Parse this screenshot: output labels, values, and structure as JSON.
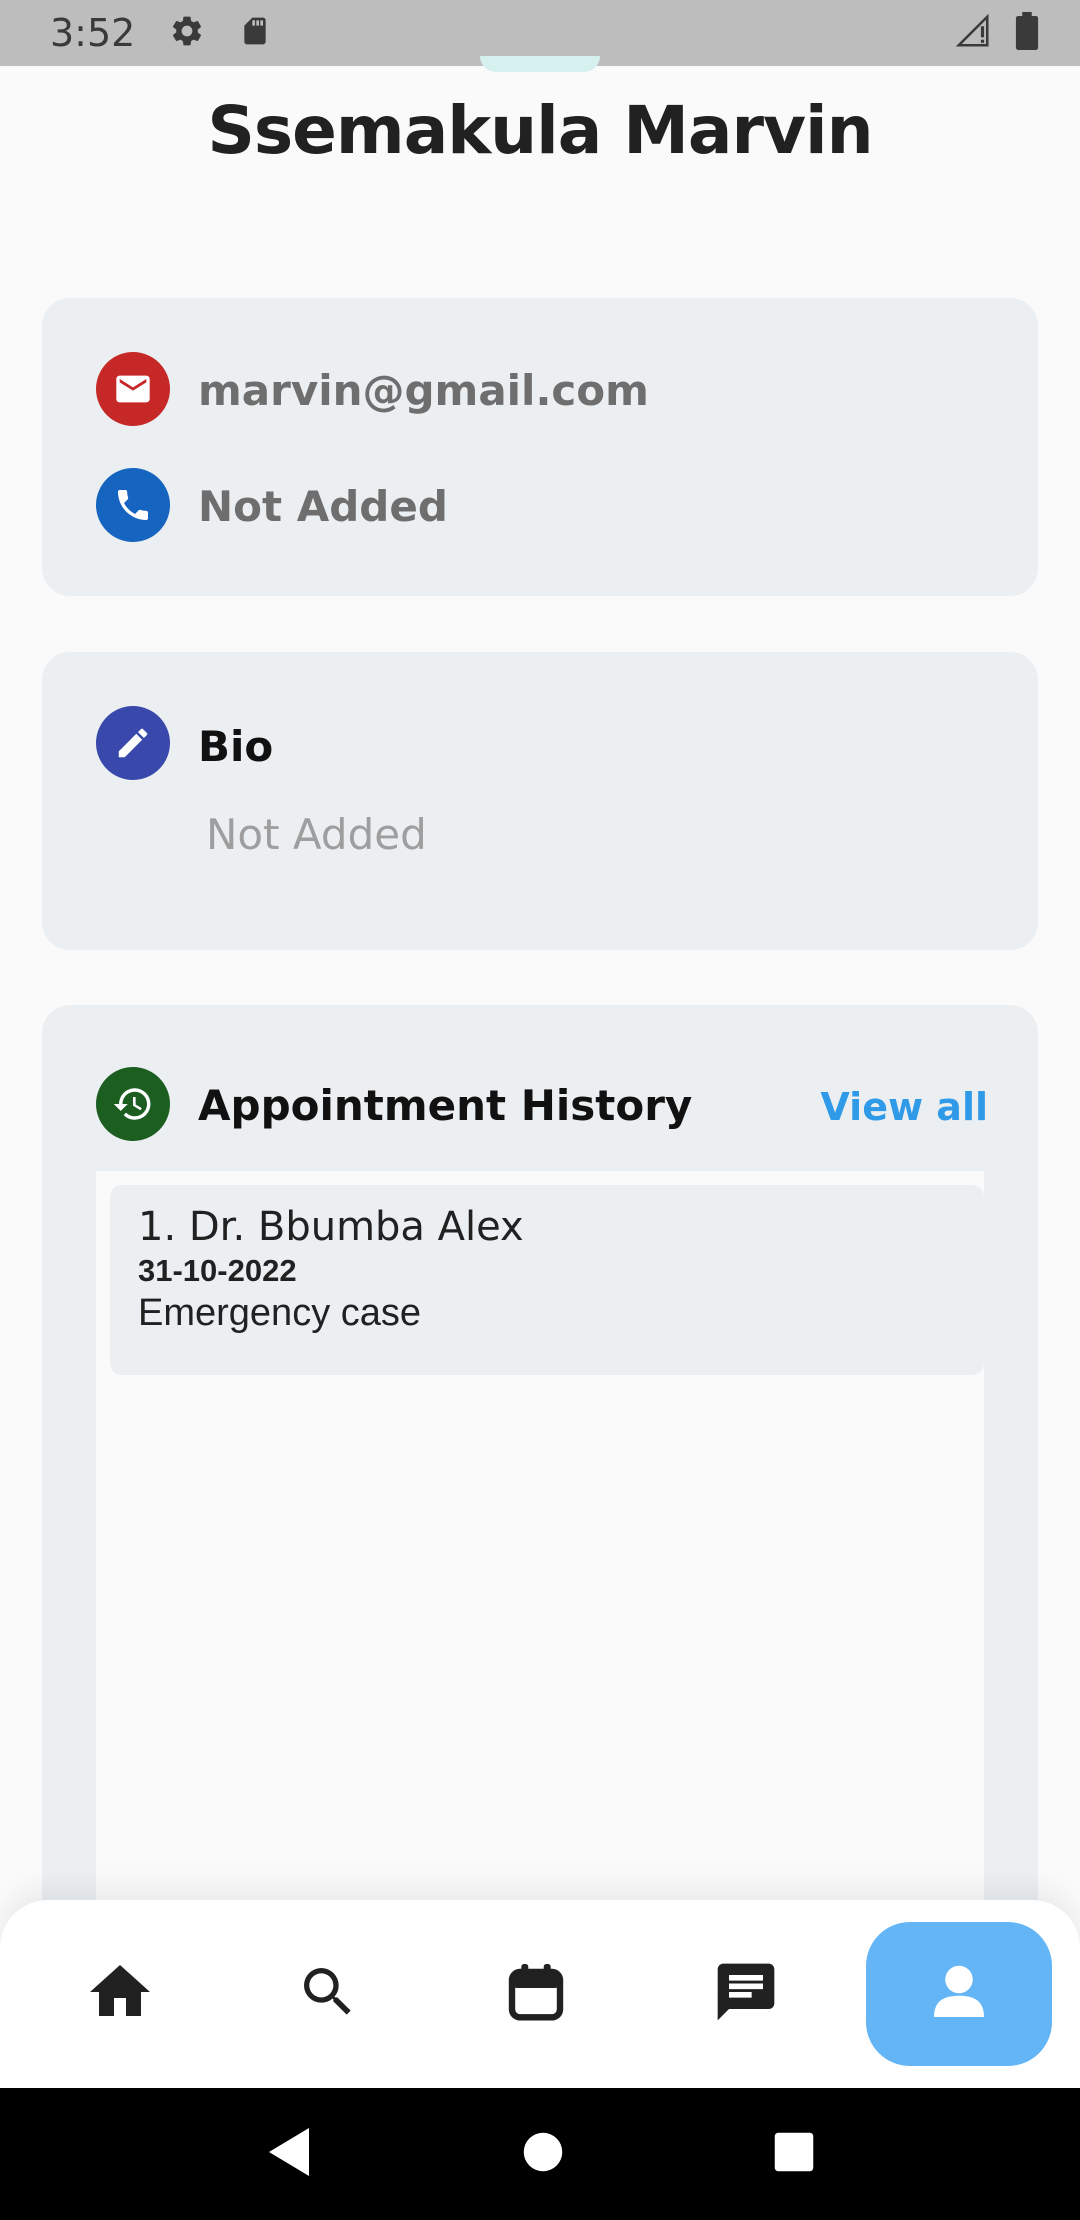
{
  "status_bar": {
    "time": "3:52",
    "left_icons": [
      "gear-icon",
      "sd-card-icon"
    ],
    "right_icons": [
      "signal-icon",
      "battery-icon"
    ]
  },
  "profile": {
    "name": "Ssemakula Marvin"
  },
  "contact": {
    "email": "marvin@gmail.com",
    "phone": "Not Added",
    "email_icon_color": "#c62828",
    "phone_icon_color": "#1565c0"
  },
  "bio": {
    "title": "Bio",
    "value": "Not Added",
    "icon_color": "#3949ab"
  },
  "appointment_history": {
    "title": "Appointment History",
    "view_all_label": "View all",
    "icon_color": "#1b5e20",
    "items": [
      {
        "doctor": "1. Dr. Bbumba Alex",
        "date": "31-10-2022",
        "reason": "Emergency case"
      }
    ]
  },
  "bottom_nav": {
    "items": [
      "home-icon",
      "search-icon",
      "calendar-icon",
      "chat-icon",
      "profile-icon"
    ],
    "active": "profile-icon",
    "active_color": "#64b5f6"
  },
  "system_nav": [
    "back-icon",
    "home-circle-icon",
    "recents-icon"
  ]
}
